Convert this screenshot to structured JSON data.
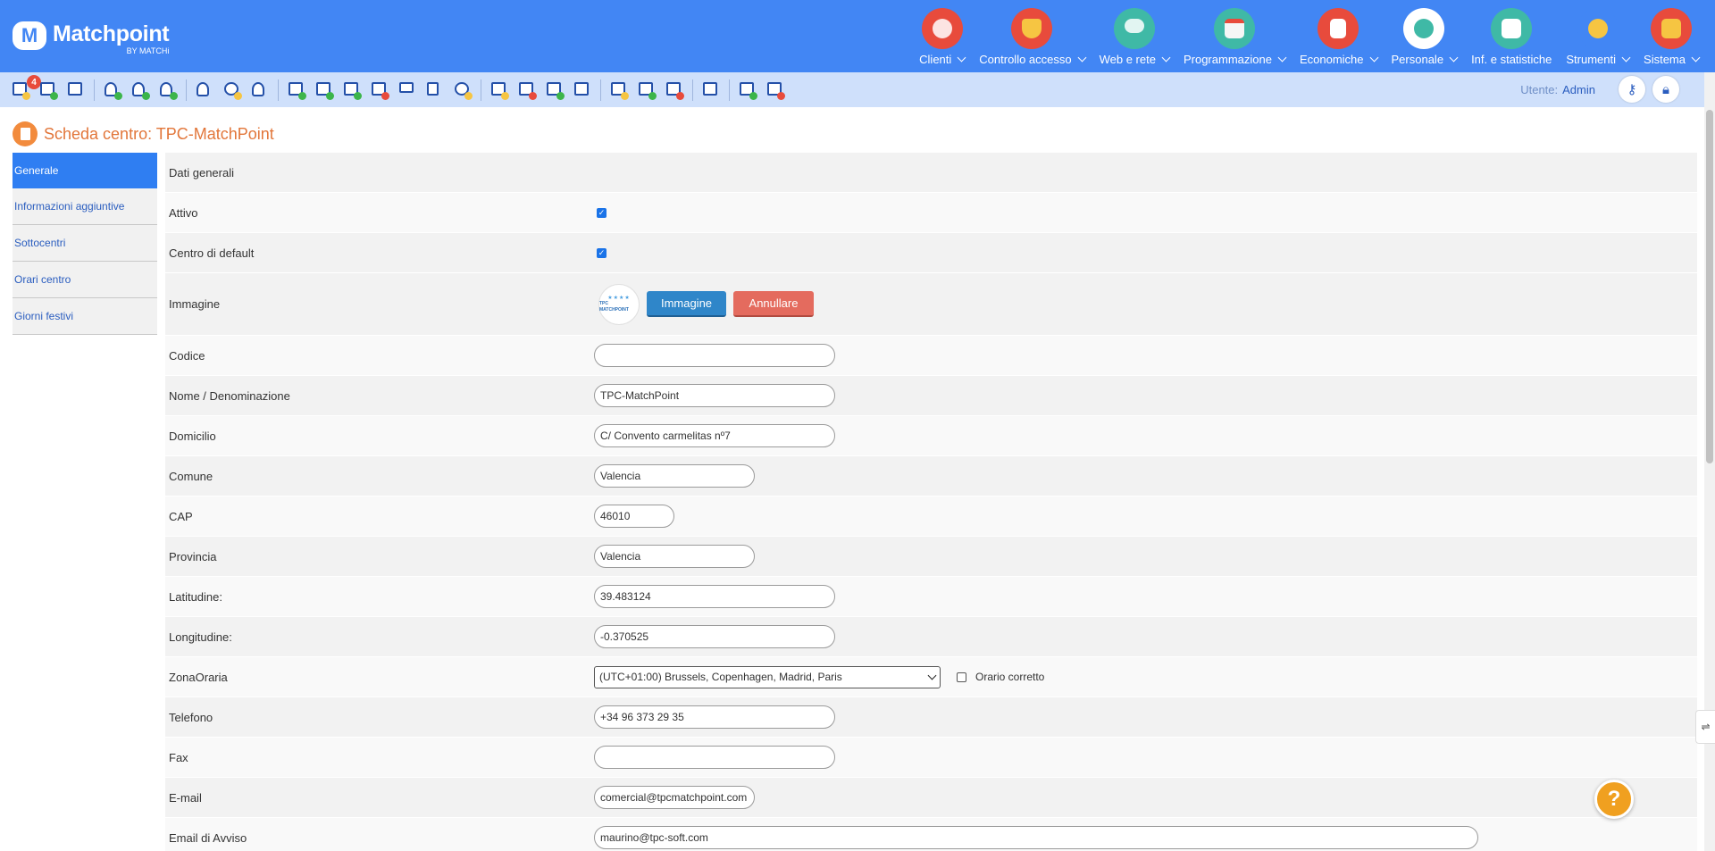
{
  "app": {
    "logo_letter": "M",
    "name": "Matchpoint",
    "by": "BY MATCHi"
  },
  "nav": [
    {
      "label": "Clienti",
      "icon": "clients-icon",
      "color": "#e84b3c"
    },
    {
      "label": "Controllo accesso",
      "icon": "access-shield-icon",
      "color": "#e84b3c"
    },
    {
      "label": "Web e rete",
      "icon": "cloud-network-icon",
      "color": "#3fb9a6"
    },
    {
      "label": "Programmazione",
      "icon": "calendar-icon",
      "color": "#3fb9a6"
    },
    {
      "label": "Economiche",
      "icon": "calculator-icon",
      "color": "#e84b3c"
    },
    {
      "label": "Personale",
      "icon": "staff-clock-icon",
      "color": "#ffffff"
    },
    {
      "label": "Inf. e statistiche",
      "icon": "stats-icon",
      "color": "#3fb9a6"
    },
    {
      "label": "Strumenti",
      "icon": "gears-icon",
      "color": "#4286f4"
    },
    {
      "label": "Sistema",
      "icon": "system-icon",
      "color": "#e84b3c"
    }
  ],
  "toolbar": {
    "badge_count": "4",
    "user_label": "Utente:",
    "user_name": "Admin",
    "key_icon": "key-icon",
    "lock_icon": "lock-icon"
  },
  "page": {
    "title": "Scheda centro: TPC-MatchPoint"
  },
  "sidemenu": [
    {
      "label": "Generale",
      "active": true
    },
    {
      "label": "Informazioni aggiuntive"
    },
    {
      "label": "Sottocentri"
    },
    {
      "label": "Orari centro"
    },
    {
      "label": "Giorni festivi"
    }
  ],
  "form": {
    "section": "Dati generali",
    "attivo_label": "Attivo",
    "attivo_checked": true,
    "default_label": "Centro di default",
    "default_checked": true,
    "immagine_label": "Immagine",
    "thumb_text": "TPC MATCHPOINT",
    "immagine_btn": "Immagine",
    "annullare_btn": "Annullare",
    "codice_label": "Codice",
    "codice_value": "",
    "nome_label": "Nome / Denominazione",
    "nome_value": "TPC-MatchPoint",
    "domicilio_label": "Domicilio",
    "domicilio_value": "C/ Convento carmelitas nº7",
    "comune_label": "Comune",
    "comune_value": "Valencia",
    "cap_label": "CAP",
    "cap_value": "46010",
    "provincia_label": "Provincia",
    "provincia_value": "Valencia",
    "lat_label": "Latitudine:",
    "lat_value": "39.483124",
    "lon_label": "Longitudine:",
    "lon_value": "-0.370525",
    "zona_label": "ZonaOraria",
    "zona_value": "(UTC+01:00) Brussels, Copenhagen, Madrid, Paris",
    "orario_label": "Orario corretto",
    "orario_checked": false,
    "tel_label": "Telefono",
    "tel_value": "+34 96 373 29 35",
    "fax_label": "Fax",
    "fax_value": "",
    "email_label": "E-mail",
    "email_value": "comercial@tpcmatchpoint.com",
    "avviso_label": "Email di Avviso",
    "avviso_value": "maurino@tpc-soft.com"
  },
  "help": {
    "label": "?"
  }
}
